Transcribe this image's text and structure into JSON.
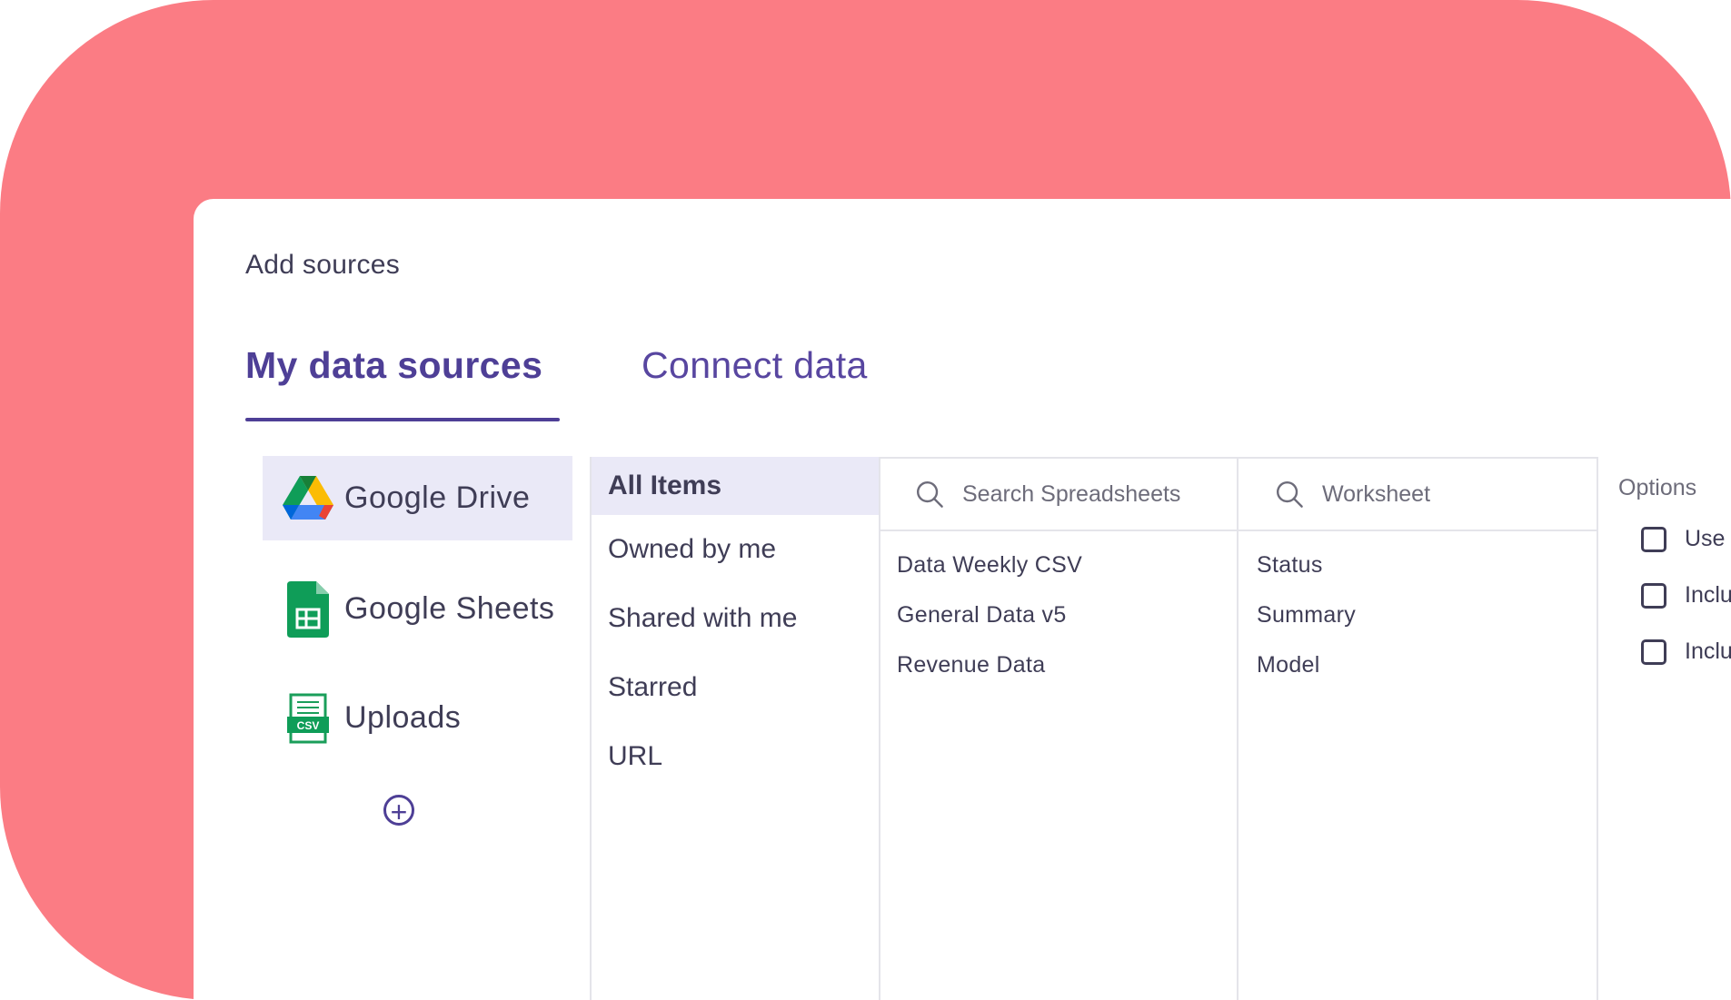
{
  "dialog": {
    "title": "Add sources"
  },
  "tabs": [
    {
      "label": "My data sources",
      "active": true
    },
    {
      "label": "Connect data",
      "active": false
    }
  ],
  "sources": [
    {
      "label": "Google Drive",
      "icon": "google-drive-icon",
      "selected": true
    },
    {
      "label": "Google Sheets",
      "icon": "google-sheets-icon",
      "selected": false
    },
    {
      "label": "Uploads",
      "icon": "csv-file-icon",
      "selected": false
    }
  ],
  "add_source_icon": "plus-circle-icon",
  "filters": [
    {
      "label": "All Items",
      "selected": true
    },
    {
      "label": "Owned by me",
      "selected": false
    },
    {
      "label": "Shared with me",
      "selected": false
    },
    {
      "label": "Starred",
      "selected": false
    },
    {
      "label": "URL",
      "selected": false
    }
  ],
  "spreadsheets": {
    "search_placeholder": "Search Spreadsheets",
    "items": [
      "Data Weekly CSV",
      "General Data v5",
      "Revenue Data"
    ]
  },
  "worksheets": {
    "search_placeholder": "Worksheet",
    "items": [
      "Status",
      "Summary",
      "Model"
    ]
  },
  "options": {
    "title": "Options",
    "items": [
      {
        "label": "Use",
        "checked": false
      },
      {
        "label": "Inclu",
        "checked": false
      },
      {
        "label": "Inclu",
        "checked": false
      }
    ]
  },
  "colors": {
    "background": "#fb7c84",
    "accent": "#4e3f96",
    "selected": "#eae9f7",
    "text": "#3f3d56"
  }
}
